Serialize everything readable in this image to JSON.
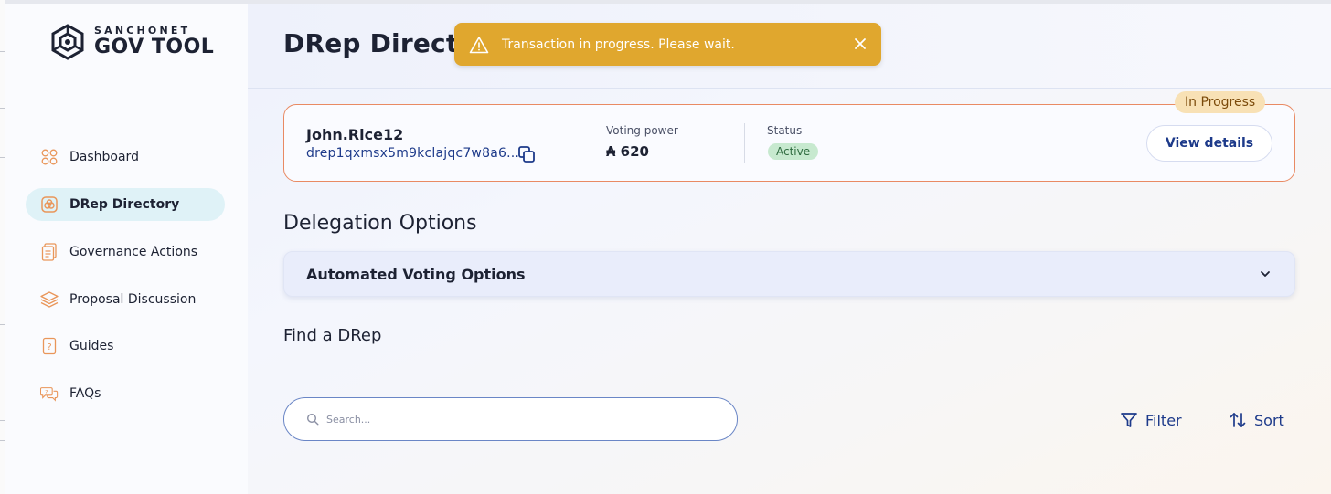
{
  "app": {
    "logo_small": "SANCHONET",
    "logo_big": "GOV TOOL"
  },
  "sidebar": {
    "items": [
      {
        "label": "Dashboard",
        "icon": "dashboard-icon"
      },
      {
        "label": "DRep Directory",
        "icon": "drep-directory-icon",
        "active": true
      },
      {
        "label": "Governance Actions",
        "icon": "governance-actions-icon"
      },
      {
        "label": "Proposal Discussion",
        "icon": "proposal-discussion-icon"
      },
      {
        "label": "Guides",
        "icon": "guides-icon"
      },
      {
        "label": "FAQs",
        "icon": "faqs-icon"
      }
    ]
  },
  "header": {
    "title": "DRep Directory"
  },
  "toast": {
    "message": "Transaction in progress. Please wait.",
    "color": "#e0a72e"
  },
  "drep_card": {
    "badge": "In Progress",
    "name": "John.Rice12",
    "id": "drep1qxmsx5m9kclajqc7w8a6...",
    "voting_power_label": "Voting power",
    "voting_power_value": "₳ 620",
    "status_label": "Status",
    "status_value": "Active",
    "view_details_label": "View details",
    "border_color": "#e98a63"
  },
  "delegation": {
    "title": "Delegation Options",
    "accordion_label": "Automated Voting Options"
  },
  "find": {
    "title": "Find a DRep",
    "search_placeholder": "Search...",
    "filter_label": "Filter",
    "sort_label": "Sort"
  },
  "colors": {
    "accent_blue": "#1d3a8a",
    "nav_active_bg": "#dff2f7",
    "icon_orange": "#e9965a"
  }
}
